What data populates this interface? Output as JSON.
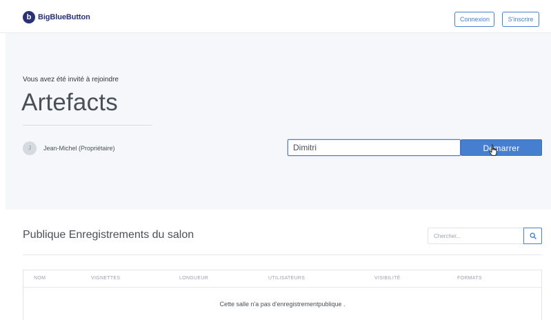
{
  "header": {
    "brand": "BigBlueButton",
    "logo_letter": "b",
    "login_label": "Connexion",
    "signup_label": "S'inscrire"
  },
  "room": {
    "invite_text": "Vous avez été invité à rejoindre",
    "name": "Artefacts",
    "owner_initial": "J",
    "owner_name": "Jean-Michel (Propriétaire)",
    "join_name_value": "Dimitri",
    "start_label": "Démarrer"
  },
  "recordings": {
    "title": "Publique Enregistrements du salon",
    "search_placeholder": "Chercher...",
    "columns": [
      "NOM",
      "VIGNETTES",
      "LONGUEUR",
      "UTILISATEURS",
      "VISIBILITÉ",
      "FORMATS"
    ],
    "empty_message": "Cette salle n'a pas d'enregistrementpublique ."
  },
  "colors": {
    "accent": "#467fcf",
    "brand": "#283274",
    "hero_bg": "#f5f7fb"
  },
  "icons": {
    "search": "search-icon",
    "cursor": "hand-pointer-icon"
  }
}
